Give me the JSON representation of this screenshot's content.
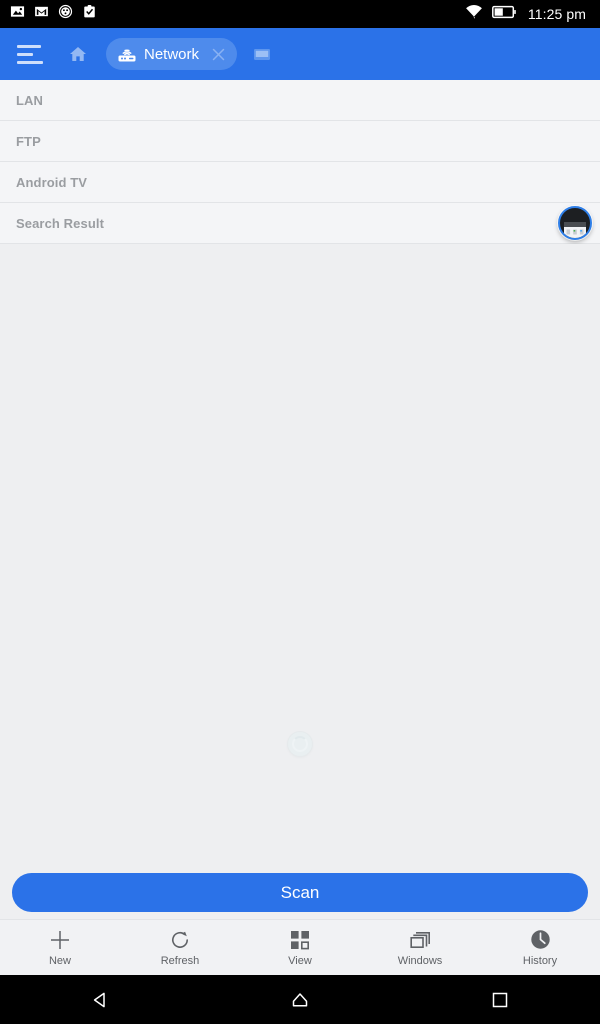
{
  "statusbar": {
    "time": "11:25 pm",
    "icons": [
      {
        "name": "photos-notification-icon"
      },
      {
        "name": "gmail-notification-icon"
      },
      {
        "name": "circle-dots-notification-icon"
      },
      {
        "name": "clipboard-check-notification-icon"
      }
    ],
    "wifi_icon": "wifi-icon",
    "battery_icon": "battery-half-icon"
  },
  "appbar": {
    "menu_icon": "hamburger-menu-icon",
    "home_icon": "home-icon",
    "tab": {
      "icon": "router-wifi-icon",
      "label": "Network",
      "close_icon": "close-icon"
    },
    "display_icon": "display-monitor-icon",
    "background_color": "#2b72e8"
  },
  "list": {
    "rows": [
      {
        "label": "LAN"
      },
      {
        "label": "FTP"
      },
      {
        "label": "Android TV"
      },
      {
        "label": "Search Result"
      }
    ]
  },
  "content": {
    "loading_spinner": "loading-spinner",
    "floating_badge": "floating-window-badge"
  },
  "scan": {
    "label": "Scan",
    "color": "#2b72e8"
  },
  "toolbar": {
    "items": [
      {
        "label": "New",
        "icon": "plus-icon"
      },
      {
        "label": "Refresh",
        "icon": "refresh-icon"
      },
      {
        "label": "View",
        "icon": "grid-view-icon"
      },
      {
        "label": "Windows",
        "icon": "windows-stack-icon"
      },
      {
        "label": "History",
        "icon": "clock-history-icon"
      }
    ]
  },
  "navbar": {
    "back_icon": "back-triangle-icon",
    "home_icon": "home-house-icon",
    "recents_icon": "recents-square-icon"
  }
}
